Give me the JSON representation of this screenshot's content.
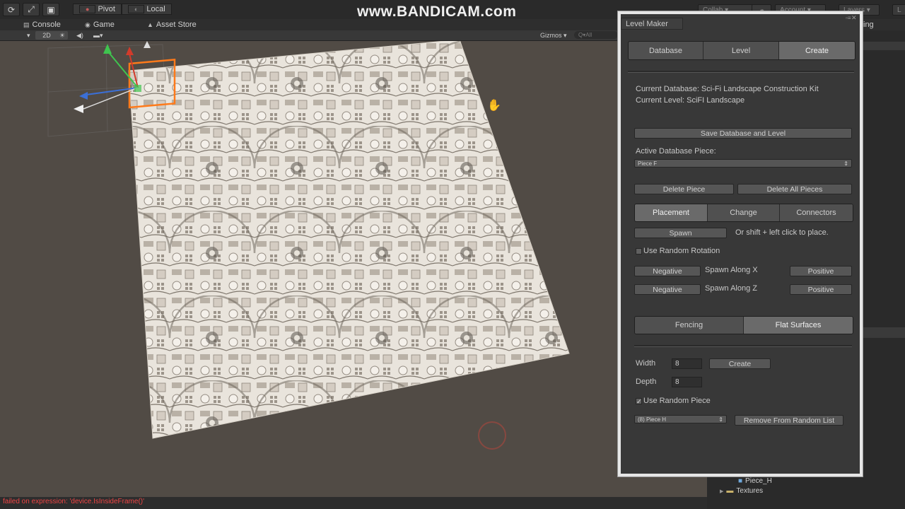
{
  "toolbar": {
    "pivot_label": "Pivot",
    "local_label": "Local",
    "collab_label": "Collab ▾",
    "account_label": "Account ▾",
    "layers_label": "Layers ▾",
    "watermark": "www.BANDICAM.com"
  },
  "tabs": {
    "console": "Console",
    "game": "Game",
    "asset_store": "Asset Store",
    "partial_right": "ing"
  },
  "scene_toolbar": {
    "mode_2d": "2D",
    "gizmos": "Gizmos ▾",
    "search_placeholder": "Q▾All"
  },
  "status": {
    "error": "failed on expression: 'device.IsInsideFrame()'"
  },
  "hierarchy": {
    "item1": "Piece_H",
    "item2": "Textures"
  },
  "level_maker": {
    "title": "Level Maker",
    "tabs": [
      "Database",
      "Level",
      "Create"
    ],
    "selected_tab": "Create",
    "current_database": "Current Database: Sci-Fi Landscape Construction Kit",
    "current_level": "Current Level: SciFI Landscape",
    "save_button": "Save Database and Level",
    "active_piece_label": "Active Database Piece:",
    "active_piece_value": "Piece F",
    "delete_piece": "Delete Piece",
    "delete_all": "Delete All Pieces",
    "mode_tabs": [
      "Placement",
      "Change",
      "Connectors"
    ],
    "selected_mode": "Placement",
    "spawn_button": "Spawn",
    "spawn_hint": "Or shift + left click to place.",
    "use_random_rotation": "Use Random Rotation",
    "negative": "Negative",
    "positive": "Positive",
    "spawn_along_x": "Spawn Along X",
    "spawn_along_z": "Spawn Along Z",
    "surface_tabs": [
      "Fencing",
      "Flat Surfaces"
    ],
    "selected_surface": "Flat Surfaces",
    "width_label": "Width",
    "width_value": "8",
    "depth_label": "Depth",
    "depth_value": "8",
    "create_button": "Create",
    "use_random_piece": "Use Random Piece",
    "random_piece_value": "(8) Piece H",
    "remove_random": "Remove From Random List"
  }
}
